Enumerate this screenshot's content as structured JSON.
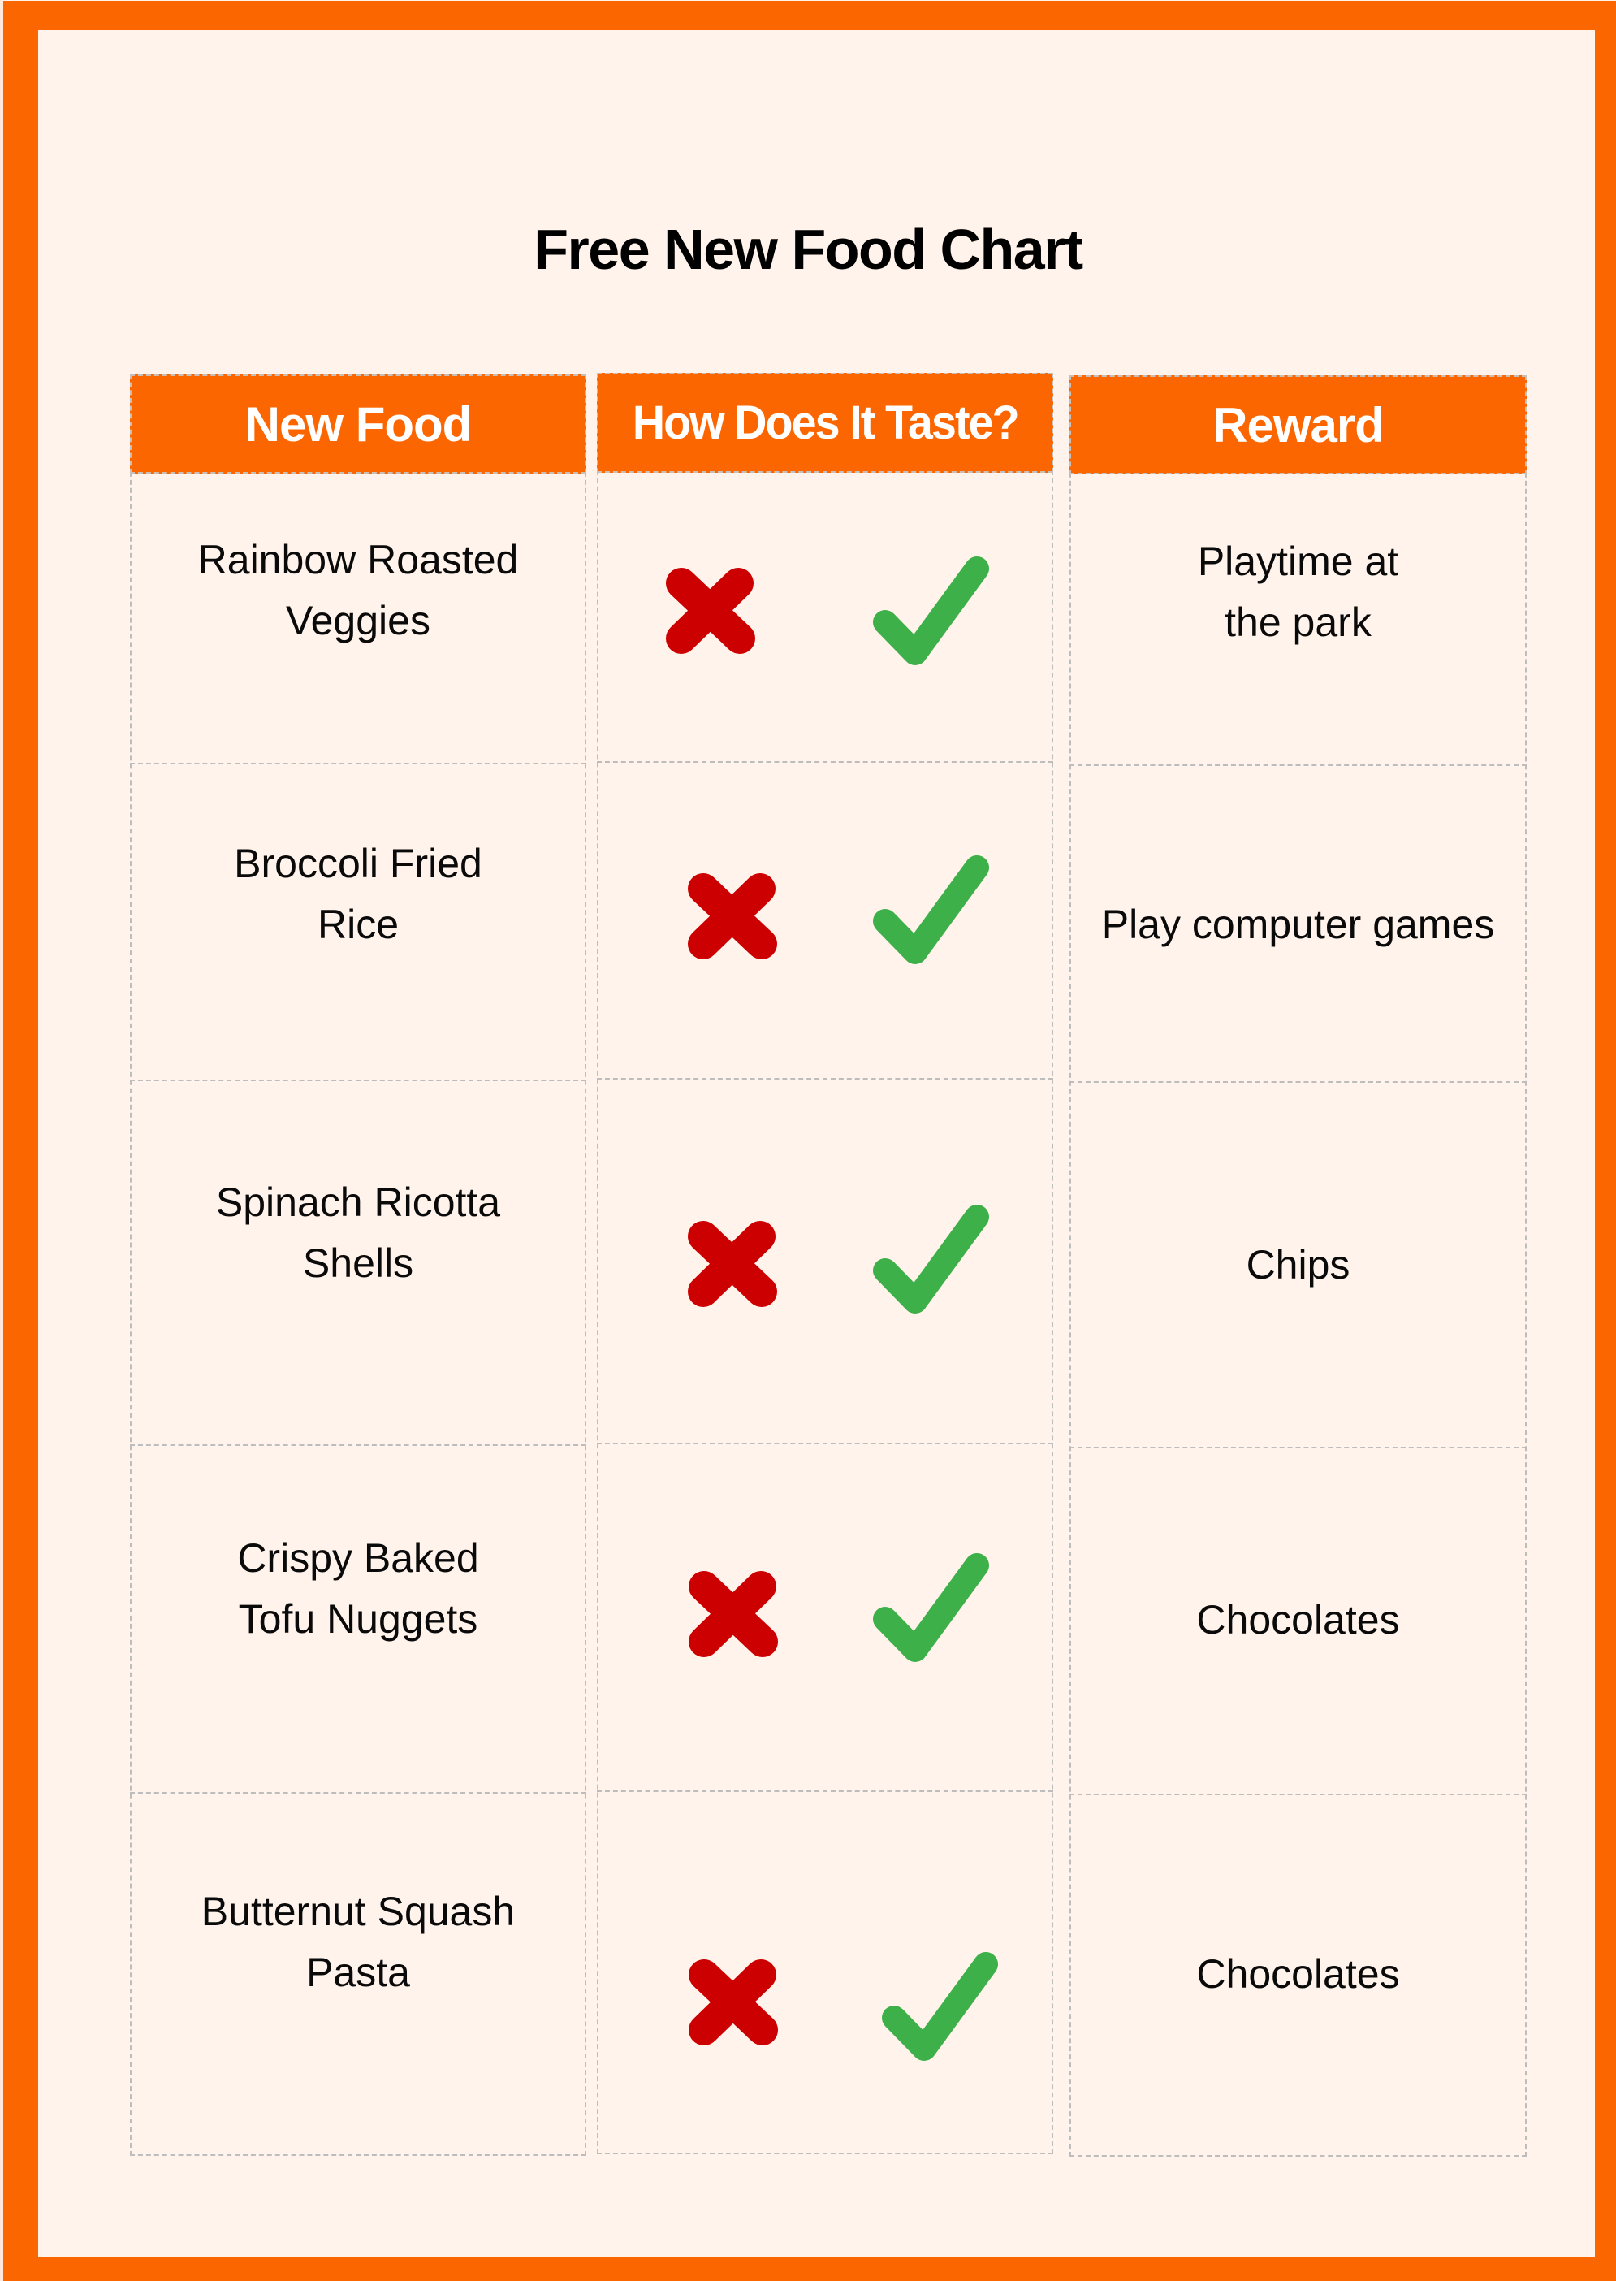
{
  "title": "Free New Food Chart",
  "colors": {
    "accent": "#FB6601",
    "background": "#FFF3EC",
    "dislike": "#CC0000",
    "like": "#3DB049",
    "grid": "#BDBDBD"
  },
  "headers": {
    "food": "New Food",
    "taste": "How Does It Taste?",
    "reward": "Reward"
  },
  "rows": [
    {
      "food": [
        "Rainbow Roasted",
        "Veggies"
      ],
      "taste_icons": [
        "x-mark-icon",
        "check-mark-icon"
      ],
      "reward": [
        "Playtime at",
        "the park"
      ]
    },
    {
      "food": [
        "Broccoli Fried",
        "Rice"
      ],
      "taste_icons": [
        "x-mark-icon",
        "check-mark-icon"
      ],
      "reward": [
        "Play computer games"
      ]
    },
    {
      "food": [
        "Spinach Ricotta",
        "Shells"
      ],
      "taste_icons": [
        "x-mark-icon",
        "check-mark-icon"
      ],
      "reward": [
        "Chips"
      ]
    },
    {
      "food": [
        "Crispy Baked",
        "Tofu Nuggets"
      ],
      "taste_icons": [
        "x-mark-icon",
        "check-mark-icon"
      ],
      "reward": [
        "Chocolates"
      ]
    },
    {
      "food": [
        "Butternut Squash",
        "Pasta"
      ],
      "taste_icons": [
        "x-mark-icon",
        "check-mark-icon"
      ],
      "reward": [
        "Chocolates"
      ]
    }
  ]
}
